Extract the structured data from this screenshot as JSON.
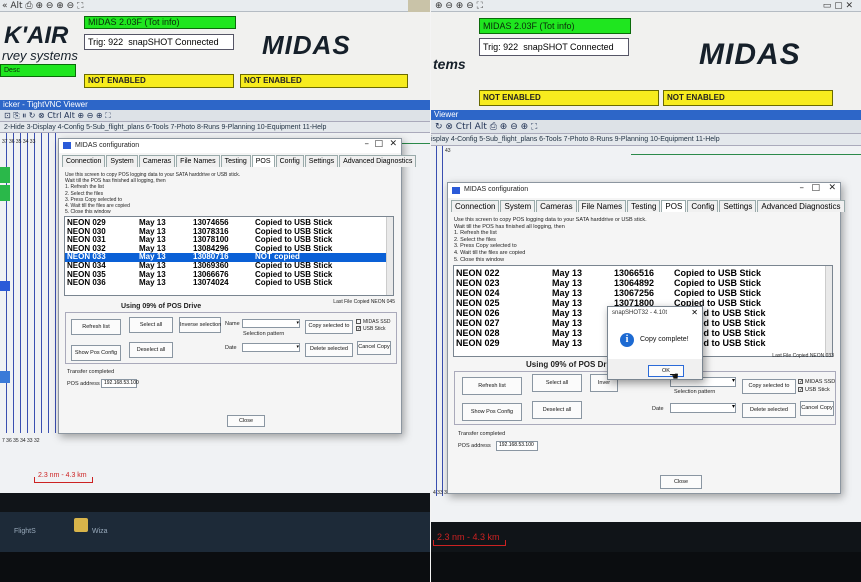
{
  "left": {
    "top_strip": {
      "glyphs": "« Alt  ⎙  ⊕ ⊖ ⊕ ⊖  ⛶"
    },
    "header": {
      "logo_line1": "K'AIR",
      "logo_line2": "rvey systems",
      "version": "MIDAS 2.03F (Tot info)",
      "trig_label": "Trig: 922",
      "trig_status": "snapSHOT Connected",
      "brand": "MIDAS",
      "status_1": "NOT ENABLED",
      "status_2": "NOT ENABLED",
      "left_stub": "Desc"
    },
    "vnc_title": "icker - TightVNC Viewer",
    "menu": "2-Hide  3-Display  4-Config  5-Sub_flight_plans  6-Tools  7-Photo  8-Runs  9-Planning  10-Equipment  11-Help",
    "dialog": {
      "title": "MIDAS configuration",
      "tabs": [
        "Connection",
        "System",
        "Cameras",
        "File Names",
        "Testing",
        "POS",
        "Config",
        "Settings",
        "Advanced Diagnostics"
      ],
      "active_tab": "POS",
      "instructions": [
        "Use this screen to copy POS logging data to your SATA harddrive or USB stick.",
        "Wait till the POS has finished all logging, then",
        "1. Refresh the list",
        "2. Select the files",
        "3. Press Copy selected to",
        "4. Wait till the files are copied",
        "5. Close this window"
      ],
      "files": [
        {
          "name": "NEON 029",
          "date": "May 13",
          "size": "13074656",
          "status": "Copied to USB Stick"
        },
        {
          "name": "NEON 030",
          "date": "May 13",
          "size": "13078316",
          "status": "Copied to USB Stick"
        },
        {
          "name": "NEON 031",
          "date": "May 13",
          "size": "13078100",
          "status": "Copied to USB Stick"
        },
        {
          "name": "NEON 032",
          "date": "May 13",
          "size": "13084296",
          "status": "Copied to USB Stick"
        },
        {
          "name": "NEON 033",
          "date": "May 13",
          "size": "13080716",
          "status": "NOT copied"
        },
        {
          "name": "NEON 034",
          "date": "May 13",
          "size": "13069360",
          "status": "Copied to USB Stick"
        },
        {
          "name": "NEON 035",
          "date": "May 13",
          "size": "13066676",
          "status": "Copied to USB Stick"
        },
        {
          "name": "NEON 036",
          "date": "May 13",
          "size": "13074024",
          "status": "Copied to USB Stick"
        }
      ],
      "last_file": "Last File Copied NEON 045",
      "using": "Using 09% of POS Drive",
      "buttons": {
        "refresh": "Refresh list",
        "select_all": "Select all",
        "inverse": "Inverse selection",
        "show_pos": "Show Pos Config",
        "deselect": "Deselect all",
        "copy_to": "Copy selected to",
        "delete": "Delete selected",
        "cancel_copy": "Cancel Copy",
        "close": "Close"
      },
      "name_label": "Name",
      "date_label": "Date",
      "selection_pattern": "Selection pattern",
      "opt_ssd": "MIDAS SSD",
      "opt_usb": "USB Stick",
      "status": "Transfer completed",
      "pos_label": "POS address",
      "pos_address": "192.168.53.100"
    },
    "side_label": "37 36 35 34 33",
    "side_label_bottom": "7 36 35 34 33 32",
    "scale": "2.3 nm  -  4.3 km",
    "taskbar": {
      "items": [
        "FlightS",
        "Wiza"
      ]
    }
  },
  "right": {
    "top_strip": {
      "glyphs": "⊕ ⊖ ⊕ ⊖  ⛶"
    },
    "header": {
      "logo_line2": "tems",
      "version": "MIDAS 2.03F (Tot info)",
      "trig_label": "Trig: 922",
      "trig_status": "snapSHOT Connected",
      "brand": "MIDAS",
      "status_1": "NOT ENABLED",
      "status_2": "NOT ENABLED"
    },
    "vnc_title": "Viewer",
    "menu": "isplay  4-Config  5-Sub_flight_plans  6-Tools  7-Photo  8-Runs  9-Planning  10-Equipment  11-Help",
    "dialog": {
      "title": "MIDAS configuration",
      "tabs": [
        "Connection",
        "System",
        "Cameras",
        "File Names",
        "Testing",
        "POS",
        "Config",
        "Settings",
        "Advanced Diagnostics"
      ],
      "instructions": [
        "Use this screen to copy POS logging data to your SATA harddrive or USB stick.",
        "Wait till the POS has finished all logging, then",
        "1. Refresh the list",
        "2. Select the files",
        "3. Press Copy selected to",
        "4. Wait till the files are copied",
        "5. Close this window"
      ],
      "files": [
        {
          "name": "NEON 022",
          "date": "May 13",
          "size": "13066516",
          "status": "Copied to USB Stick"
        },
        {
          "name": "NEON 023",
          "date": "May 13",
          "size": "13064892",
          "status": "Copied to USB Stick"
        },
        {
          "name": "NEON 024",
          "date": "May 13",
          "size": "13067256",
          "status": "Copied to USB Stick"
        },
        {
          "name": "NEON 025",
          "date": "May 13",
          "size": "13071800",
          "status": "Copied to USB Stick"
        },
        {
          "name": "NEON 026",
          "date": "May 13",
          "size": "",
          "status": "ied to USB Stick"
        },
        {
          "name": "NEON 027",
          "date": "May 13",
          "size": "",
          "status": "ied to USB Stick"
        },
        {
          "name": "NEON 028",
          "date": "May 13",
          "size": "",
          "status": "ied to USB Stick"
        },
        {
          "name": "NEON 029",
          "date": "May 13",
          "size": "",
          "status": "ied to USB Stick"
        }
      ],
      "last_file": "Last File Copied NEON 033",
      "using": "Using 09% of POS Driv",
      "buttons": {
        "refresh": "Refresh list",
        "select_all": "Select all",
        "inverse": "Inver",
        "show_pos": "Show Pos Config",
        "deselect": "Deselect all",
        "copy_to": "Copy selected to",
        "delete": "Delete selected",
        "cancel_copy": "Cancel Copy",
        "close": "Close"
      },
      "date_label": "Date",
      "selection_pattern": "Selection pattern",
      "opt_ssd": "MIDAS SSD",
      "opt_usb": "USB Stick",
      "status": "Transfer completed",
      "pos_label": "POS address",
      "pos_address": "192.168.53.100"
    },
    "popup": {
      "title": "snapSHOT32 - 4.10t",
      "message": "Copy complete!",
      "ok": "OK"
    },
    "side_label": "43",
    "side_label_bottom": "4 33 32",
    "scale": "2.3 nm  -  4.3 km"
  }
}
